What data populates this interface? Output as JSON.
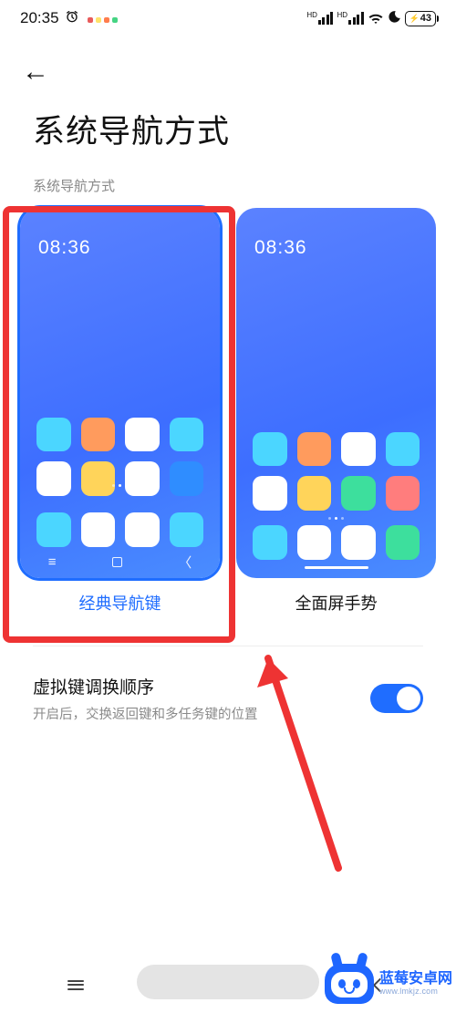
{
  "status": {
    "time": "20:35",
    "alarm_icon": "alarm-icon",
    "app_dots": [
      "#e85b5b",
      "#ffe36b",
      "#ff7d4d",
      "#45d483"
    ],
    "sig_label": "HD",
    "battery_pct": "43"
  },
  "page": {
    "back_glyph": "←",
    "title": "系统导航方式",
    "section_label": "系统导航方式"
  },
  "options": [
    {
      "id": "classic",
      "label": "经典导航键",
      "selected": true,
      "preview_time": "08:36",
      "grid_colors": [
        "c-cy",
        "c-or",
        "c-wh",
        "c-cy",
        "c-wh",
        "c-ye",
        "c-wh",
        "c-bl"
      ],
      "dock_colors": [
        "c-cy",
        "c-wh",
        "c-wh",
        "c-cy"
      ],
      "nav_style": "three_button"
    },
    {
      "id": "gesture",
      "label": "全面屏手势",
      "selected": false,
      "preview_time": "08:36",
      "grid_colors": [
        "c-cy",
        "c-or",
        "c-wh",
        "c-cy",
        "c-wh",
        "c-ye",
        "c-gr",
        "c-rd"
      ],
      "dock_colors": [
        "c-cy",
        "c-wh",
        "c-wh",
        "c-gr"
      ],
      "nav_style": "gesture_bar"
    }
  ],
  "setting": {
    "title": "虚拟键调换顺序",
    "subtitle": "开启后，交换返回键和多任务键的位置",
    "enabled": true
  },
  "annotation": {
    "highlight_target": "classic",
    "arrow": true
  },
  "sys_nav": {
    "buttons": [
      "recents",
      "home",
      "back"
    ]
  },
  "watermark": {
    "name": "蓝莓安卓网",
    "url": "www.lmkjz.com"
  }
}
